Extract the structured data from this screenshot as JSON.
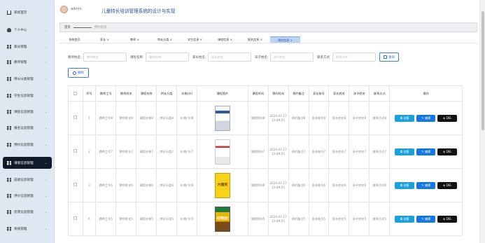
{
  "app": {
    "user": "admin",
    "title": "儿童特长培训管理系统的设计与实现"
  },
  "sidebar": {
    "items": [
      {
        "label": "系统首页",
        "icon": "home-icon",
        "has_children": false
      },
      {
        "label": "个人中心",
        "icon": "user-icon",
        "has_children": true
      },
      {
        "label": "家长管理",
        "icon": "grid-icon",
        "has_children": true
      },
      {
        "label": "教师管理",
        "icon": "grid-icon",
        "has_children": true
      },
      {
        "label": "特长分类管理",
        "icon": "grid-icon",
        "has_children": true
      },
      {
        "label": "学生信息管理",
        "icon": "grid-icon",
        "has_children": true
      },
      {
        "label": "课程信息管理",
        "icon": "grid-icon",
        "has_children": true
      },
      {
        "label": "报名信息管理",
        "icon": "grid-icon",
        "has_children": true
      },
      {
        "label": "预约信息管理",
        "icon": "grid-icon",
        "has_children": true
      },
      {
        "label": "请假信息管理",
        "icon": "grid-icon",
        "has_children": true,
        "active": true
      },
      {
        "label": "成绩信息管理",
        "icon": "grid-icon",
        "has_children": true
      },
      {
        "label": "评价信息管理",
        "icon": "grid-icon",
        "has_children": true
      },
      {
        "label": "反馈信息管理",
        "icon": "grid-icon",
        "has_children": true
      },
      {
        "label": "系统管理",
        "icon": "grid-icon",
        "has_children": true
      }
    ]
  },
  "breadcrumb": {
    "home": "首页",
    "current": "预约信息"
  },
  "tabs": [
    {
      "label": "系统首页"
    },
    {
      "label": "家长 ×"
    },
    {
      "label": "教师 ×"
    },
    {
      "label": "特长分类 ×"
    },
    {
      "label": "学生信息 ×"
    },
    {
      "label": "课程信息 ×"
    },
    {
      "label": "报名信息 ×"
    },
    {
      "label": "预约信息 ×",
      "active": true
    }
  ],
  "search": {
    "fields": [
      {
        "label": "教师姓名",
        "placeholder": "教师姓名"
      },
      {
        "label": "课程名称",
        "placeholder": "课程名称"
      },
      {
        "label": "家长姓名",
        "placeholder": "家长姓名"
      },
      {
        "label": "孩子姓名",
        "placeholder": "孩子姓名"
      },
      {
        "label": "联系方式",
        "placeholder": "联系方式"
      }
    ],
    "query_label": "查询"
  },
  "actions": {
    "delete_label": "删除"
  },
  "table": {
    "columns": [
      "",
      "序号",
      "教师工号",
      "教师姓名",
      "课程名称",
      "特长分类",
      "价格(节)",
      "课程图片",
      "课程时间",
      "预约时间",
      "预约备注",
      "家长账号",
      "家长姓名",
      "孩子姓名",
      "联系方式",
      "操作"
    ],
    "rows": [
      {
        "index": "1",
        "teacher_id": "教师工号8",
        "teacher_name": "教师姓名8",
        "course_name": "课程名称8",
        "category": "特长分类8",
        "price": "价格(节)8",
        "image_title": "",
        "course_time": "课程时间8",
        "appoint_time": "2024-01-17 13:48:03",
        "remark": "预约备注8",
        "parent_account": "家长账号8",
        "parent_name": "家长姓名8",
        "child_name": "孩子姓名8",
        "contact": "联系方式8"
      },
      {
        "index": "2",
        "teacher_id": "教师工号7",
        "teacher_name": "教师姓名7",
        "course_name": "课程名称7",
        "category": "特长分类7",
        "price": "价格(节)7",
        "image_title": "",
        "course_time": "课程时间7",
        "appoint_time": "2024-01-17 13:48:03",
        "remark": "预约备注7",
        "parent_account": "家长账号7",
        "parent_name": "家长姓名7",
        "child_name": "孩子姓名7",
        "contact": "联系方式7"
      },
      {
        "index": "3",
        "teacher_id": "教师工号6",
        "teacher_name": "教师姓名6",
        "course_name": "课程名称6",
        "category": "特长分类6",
        "price": "价格(节)6",
        "image_title": "大猫奖",
        "course_time": "课程时间6",
        "appoint_time": "2024-01-17 13:48:03",
        "remark": "预约备注6",
        "parent_account": "家长账号6",
        "parent_name": "家长姓名6",
        "child_name": "孩子姓名6",
        "contact": "联系方式6"
      },
      {
        "index": "4",
        "teacher_id": "教师工号5",
        "teacher_name": "教师姓名5",
        "course_name": "课程名称5",
        "category": "特长分类5",
        "price": "价格(节)5",
        "image_title": "动物运动会",
        "course_time": "课程时间5",
        "appoint_time": "2024-01-17 13:48:03",
        "remark": "预约备注5",
        "parent_account": "家长账号5",
        "parent_name": "家长姓名5",
        "child_name": "孩子姓名5",
        "contact": "联系方式5"
      }
    ],
    "row_actions": {
      "detail": "详情",
      "edit": "编辑",
      "delete": "DEL"
    }
  },
  "colors": {
    "sidebar_bg": "#dfe7f2",
    "active_item": "#0f1b2b",
    "title": "#2a4a9a",
    "detail_button": "#1ea0e0",
    "edit_button": "#1476e0",
    "del_button": "#111111"
  }
}
